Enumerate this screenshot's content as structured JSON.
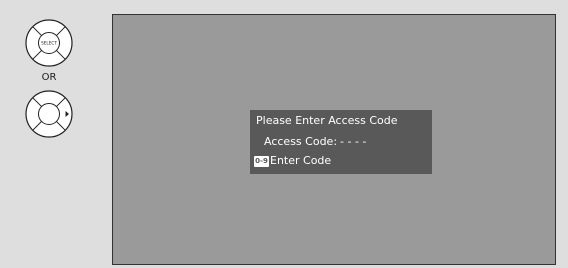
{
  "remote": {
    "select_label": "SELECT",
    "or_label": "OR"
  },
  "dialog": {
    "title": "Please Enter Access Code",
    "code_label": "Access Code:",
    "code_value": "- - - -",
    "hint_key": "0-9",
    "hint_text": "Enter Code"
  },
  "colors": {
    "background": "#dedede",
    "screen": "#9b9a9a",
    "dialog": "#595959",
    "dialog_text": "#ffffff"
  }
}
